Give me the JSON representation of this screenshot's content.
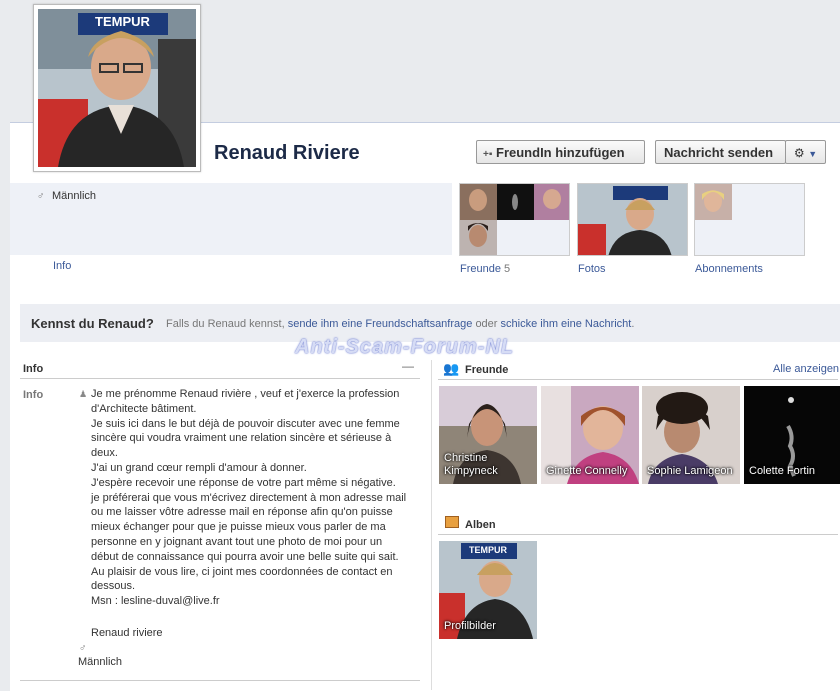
{
  "profile": {
    "name": "Renaud Riviere",
    "gender_label": "Männlich",
    "info_tab": "Info"
  },
  "actions": {
    "add_friend": "FreundIn hinzufügen",
    "send_message": "Nachricht senden"
  },
  "tiles": {
    "friends_label": "Freunde",
    "friends_count": "5",
    "photos_label": "Fotos",
    "subscriptions_label": "Abonnements"
  },
  "kennst": {
    "title": "Kennst du Renaud?",
    "prefix": "Falls du Renaud kennst,",
    "link1": "sende ihm eine Freundschaftsanfrage",
    "middle": "oder",
    "link2": "schicke ihm eine Nachricht",
    "suffix": "."
  },
  "watermark": "Anti-Scam-Forum-NL",
  "info_section": {
    "title": "Info",
    "minimize": "—",
    "row_label": "Info",
    "bio": [
      "Je me prénomme Renaud rivière , veuf et j'exerce la profession d'Architecte bâtiment.",
      "Je suis ici dans le but déjà de pouvoir discuter avec une femme sincère qui voudra vraiment une relation sincère et sérieuse à deux.",
      "J'ai un grand cœur rempli d'amour à donner.",
      "J'espère recevoir une réponse de votre part même si négative.",
      "je préférerai que vous m'écrivez directement à mon adresse mail ou me laisser vôtre adresse mail en réponse afin qu'on puisse mieux échanger pour que je puisse mieux vous parler de ma personne en y joignant avant tout une photo de moi pour un début de connaissance qui pourra avoir une belle suite qui sait.",
      "Au plaisir de vous lire, ci joint mes coordonnées de contact en dessous.",
      "Msn : lesline-duval@live.fr",
      "",
      "Renaud riviere"
    ],
    "gender": "Männlich"
  },
  "friends_section": {
    "title": "Freunde",
    "see_all": "Alle anzeigen",
    "friends": [
      {
        "name": "Christine Kimpyneck"
      },
      {
        "name": "Ginette Connelly"
      },
      {
        "name": "Sophie Lamigeon"
      },
      {
        "name": "Colette Fortin"
      }
    ]
  },
  "albums_section": {
    "title": "Alben",
    "albums": [
      {
        "name": "Profilbilder"
      }
    ]
  },
  "photo_sign": "TEMPUR",
  "colors": {
    "link": "#3b5998",
    "name": "#1c2a47",
    "strip": "#eef1f7"
  }
}
